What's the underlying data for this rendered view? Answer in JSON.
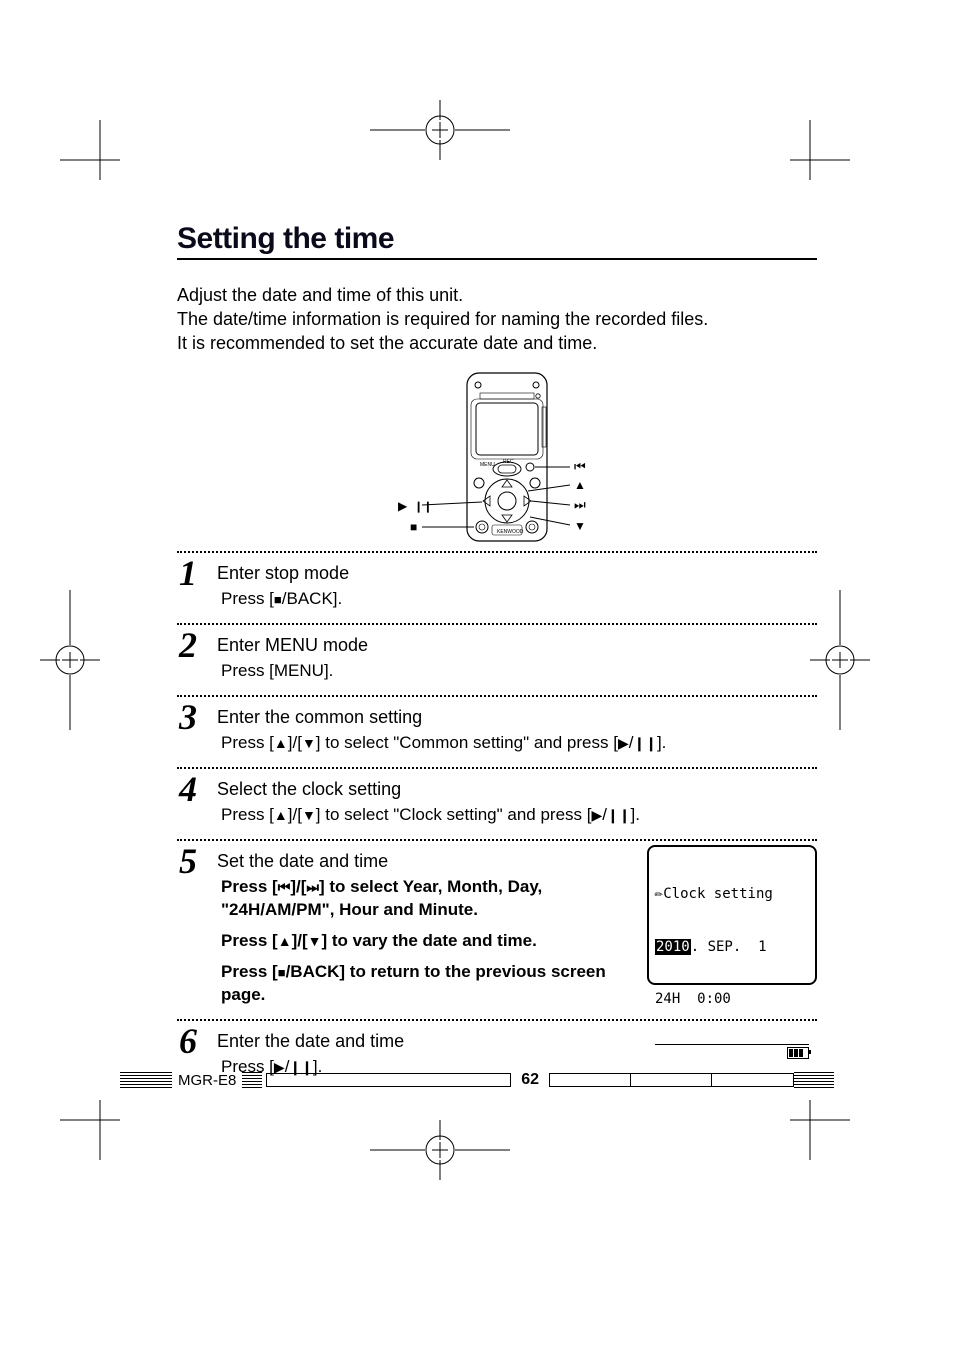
{
  "section_title": "Setting the time",
  "intro": {
    "line1": "Adjust the date and time of this unit.",
    "line2": "The date/time information is required for naming the recorded files.",
    "line3": "It is recommended to set the accurate date and time."
  },
  "device_labels": {
    "prev": "⏮",
    "next": "⏭",
    "up": "▲",
    "down": "▼",
    "play": "▶",
    "pause": "❙❙",
    "stop": "■"
  },
  "steps": [
    {
      "n": "1",
      "title": "Enter stop mode",
      "body_html": "Press [<span class='glyph glyph-stop'>■</span>/BACK]."
    },
    {
      "n": "2",
      "title": "Enter MENU mode",
      "body_html": "Press [MENU]."
    },
    {
      "n": "3",
      "title": "Enter the common setting",
      "body_html": "Press [<span class='glyph'>▲</span>]/[<span class='glyph'>▼</span>] to select \"Common setting\" and press [<span class='glyph'>▶</span>/<span class='glyph'>❙❙</span>]."
    },
    {
      "n": "4",
      "title": "Select the clock setting",
      "body_html": "Press [<span class='glyph'>▲</span>]/[<span class='glyph'>▼</span>] to select \"Clock setting\" and press [<span class='glyph'>▶</span>/<span class='glyph'>❙❙</span>]."
    },
    {
      "n": "5",
      "title": "Set the date and time",
      "body_lines": [
        "Press [<span class='glyph'>⏮</span>]/[<span class='glyph'>⏭</span>] to select Year, Month, Day, \"24H/AM/PM\", Hour and Minute.",
        "Press [<span class='glyph'>▲</span>]/[<span class='glyph'>▼</span>] to vary the date and time.",
        "Press [<span class='glyph glyph-stop'>■</span>/BACK] to return to the previous screen page."
      ]
    },
    {
      "n": "6",
      "title": "Enter the date and time",
      "body_html": "Press [<span class='glyph'>▶</span>/<span class='glyph'>❙❙</span>]."
    }
  ],
  "lcd": {
    "header": "Clock setting",
    "year": "2010",
    "rest_date": ". SEP.  1",
    "time_line": "24H  0:00"
  },
  "footer": {
    "model": "MGR-E8",
    "page_number": "62"
  }
}
